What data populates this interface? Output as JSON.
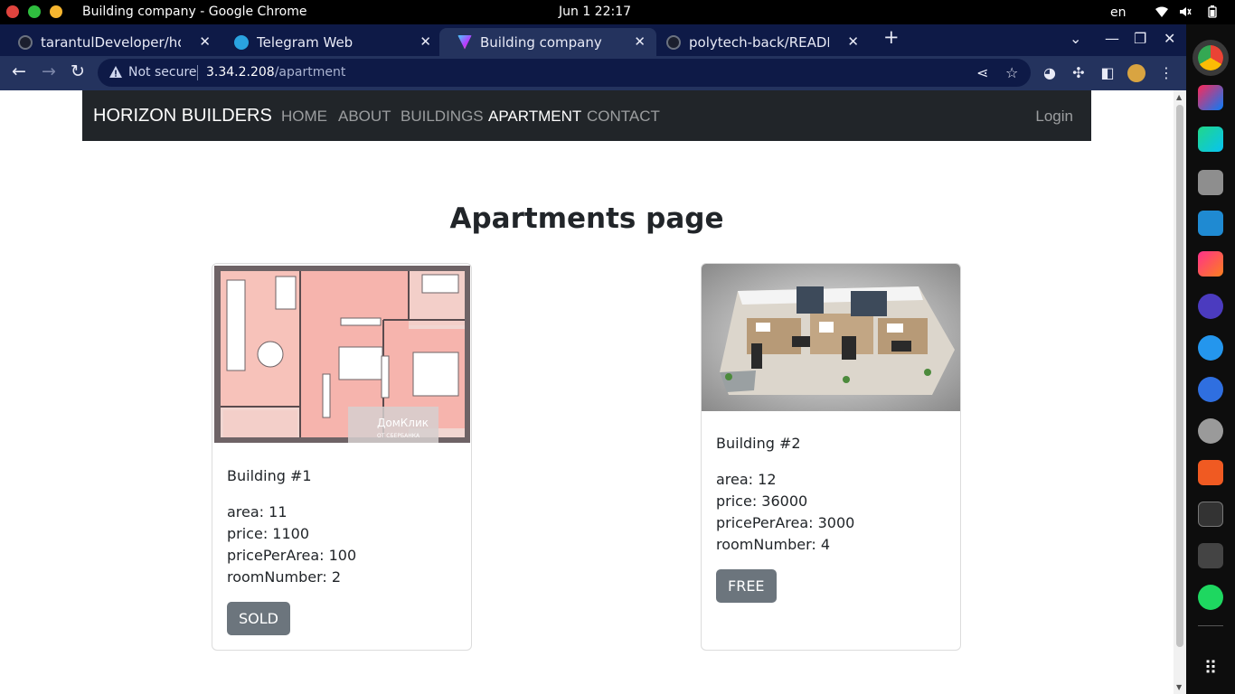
{
  "os": {
    "window_title": "Building company - Google Chrome",
    "clock": "Jun 1  22:17",
    "lang": "en"
  },
  "browser": {
    "tabs": [
      {
        "label": "tarantulDeveloper/horizo",
        "icon": "github-icon"
      },
      {
        "label": "Telegram Web",
        "icon": "telegram-icon"
      },
      {
        "label": "Building company",
        "icon": "vite-icon",
        "active": true
      },
      {
        "label": "polytech-back/README.m",
        "icon": "github-icon"
      }
    ],
    "omnibox": {
      "security_text": "Not secure",
      "url_host": "3.34.2.208",
      "url_path": "/apartment"
    }
  },
  "site": {
    "brand": "HORIZON BUILDERS",
    "nav": [
      "HOME",
      "ABOUT",
      "BUILDINGS",
      "APARTMENT",
      "CONTACT"
    ],
    "active_nav": "APARTMENT",
    "login": "Login",
    "page_title": "Apartments page",
    "cards": [
      {
        "building": "Building #1",
        "area": "area: 11",
        "price": "price: 1100",
        "price_per_area": "pricePerArea: 100",
        "room_number": "roomNumber: 2",
        "status": "SOLD",
        "watermark": "ДомКлик от СБЕРБАНКА"
      },
      {
        "building": "Building #2",
        "area": "area: 12",
        "price": "price: 36000",
        "price_per_area": "pricePerArea: 3000",
        "room_number": "roomNumber: 4",
        "status": "FREE"
      }
    ]
  },
  "colors": {
    "site_nav_bg": "#212529",
    "status_button": "#6c757d",
    "chrome_tabstrip": "#0e1a47",
    "chrome_toolbar": "#24335e"
  }
}
